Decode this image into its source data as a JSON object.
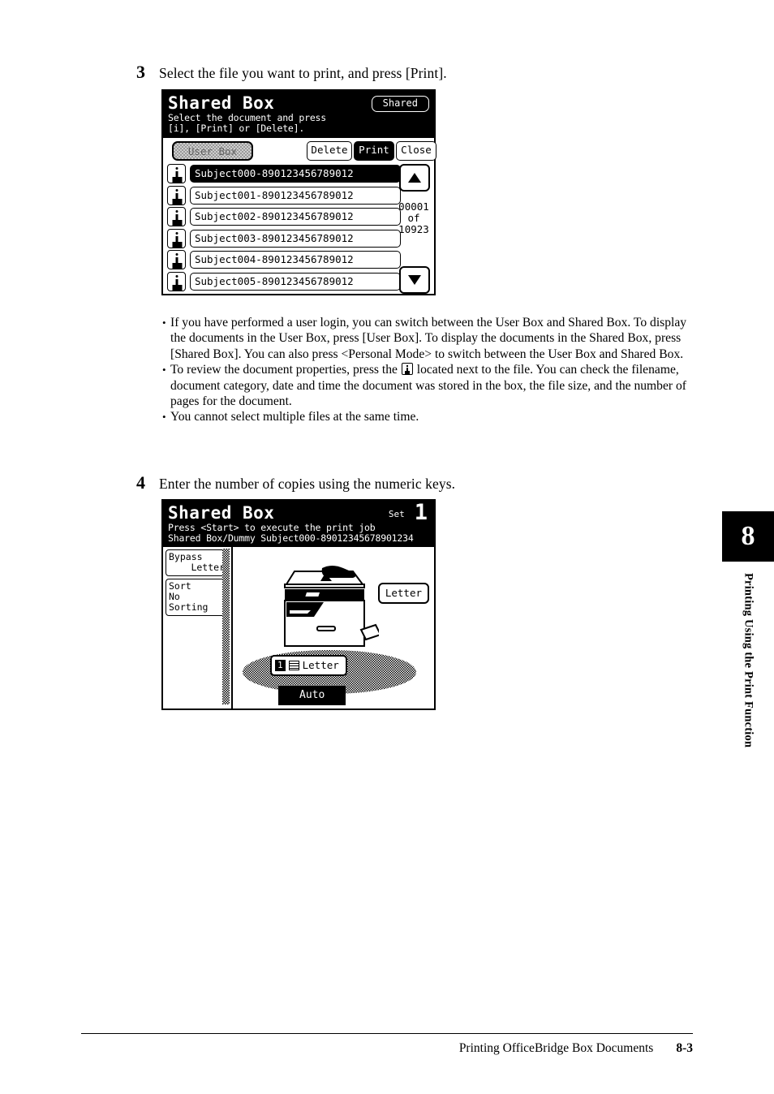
{
  "steps": [
    {
      "number": "3",
      "text": "Select the file you want to print, and press [Print]."
    },
    {
      "number": "4",
      "text": "Enter the number of copies using the numeric keys."
    }
  ],
  "screen_list": {
    "title": "Shared Box",
    "subtitle_line1": "Select the document and press",
    "subtitle_line2": "[i], [Print] or [Delete].",
    "mode_button": "Shared",
    "toolbar": {
      "user_box": "User Box",
      "delete": "Delete",
      "print": "Print",
      "close": "Close"
    },
    "documents": [
      {
        "name": "Subject000-890123456789012",
        "selected": true
      },
      {
        "name": "Subject001-890123456789012",
        "selected": false
      },
      {
        "name": "Subject002-890123456789012",
        "selected": false
      },
      {
        "name": "Subject003-890123456789012",
        "selected": false
      },
      {
        "name": "Subject004-890123456789012",
        "selected": false
      },
      {
        "name": "Subject005-890123456789012",
        "selected": false
      }
    ],
    "counter": {
      "current": "00001",
      "of": "of",
      "total": "10923"
    },
    "scroll_up_icon": "triangle-up-icon",
    "scroll_down_icon": "triangle-down-icon",
    "info_icon": "document-info-icon"
  },
  "screen_print": {
    "title": "Shared Box",
    "set_label": "Set",
    "set_value": "1",
    "subtitle_line1": "Press <Start> to execute the print job",
    "subtitle_line2": "Shared Box/Dummy Subject000-89012345678901234",
    "side_buttons": [
      {
        "line1": "Bypass",
        "line2": "Letter",
        "line2_align": "right"
      },
      {
        "line1": "Sort",
        "line2": "No Sorting",
        "line2_align": "left"
      }
    ],
    "paper_size_button": "Letter",
    "tray": {
      "number": "1",
      "icon": "paper-stack-icon",
      "label": "Letter"
    },
    "auto_button": "Auto",
    "printer_icon": "printer-illustration"
  },
  "notes": [
    {
      "bullet": "•",
      "segments": [
        {
          "type": "text",
          "value": "If you have performed a user login, you can switch between the User Box and Shared Box. To display the documents in the User Box, press [User Box]. To display the documents in the Shared Box, press [Shared Box]. You can also press <Personal Mode> to switch between the User Box and Shared Box."
        }
      ]
    },
    {
      "bullet": "•",
      "segments": [
        {
          "type": "text",
          "value": "To review the document properties, press the "
        },
        {
          "type": "icon",
          "value": "document-info-icon"
        },
        {
          "type": "text",
          "value": " located next to the file. You can check the filename, document category, date and time the document was stored in the box, the file size, and the number of pages for the document."
        }
      ]
    },
    {
      "bullet": "•",
      "segments": [
        {
          "type": "text",
          "value": "You cannot select multiple files at the same time."
        }
      ]
    }
  ],
  "chapter": {
    "number": "8",
    "label": "Printing Using the Print Function"
  },
  "footer": {
    "title": "Printing OfficeBridge Box Documents",
    "page": "8-3"
  }
}
